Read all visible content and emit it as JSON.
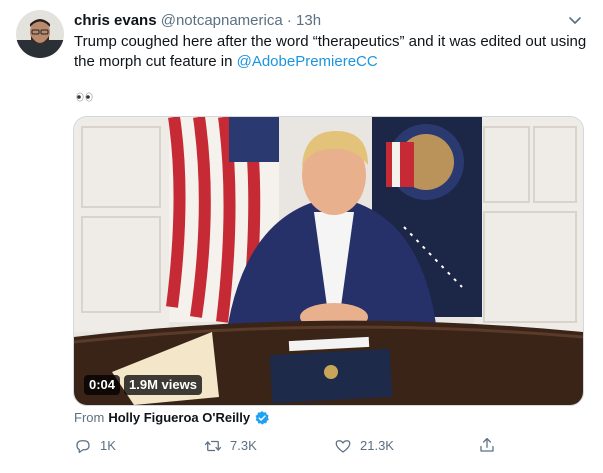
{
  "tweet": {
    "display_name": "chris evans",
    "handle": "@notcapnamerica",
    "separator": "·",
    "time": "13h",
    "text_before_mention": "Trump coughed here after the word “therapeutics” and it was edited out using the morph cut feature in ",
    "mention": "@AdobePremiereCC",
    "emoji_icon": "eyes-emoji-icon"
  },
  "media": {
    "duration": "0:04",
    "views": "1.9M views"
  },
  "attribution": {
    "prefix": "From",
    "source_name": "Holly Figueroa O'Reilly",
    "verified_icon": "verified-badge-icon"
  },
  "actions": {
    "reply_count": "1K",
    "retweet_count": "7.3K",
    "like_count": "21.3K"
  },
  "colors": {
    "link": "#1b95e0",
    "muted": "#5b7083",
    "text": "#0f1419",
    "border": "#cfd9de"
  }
}
